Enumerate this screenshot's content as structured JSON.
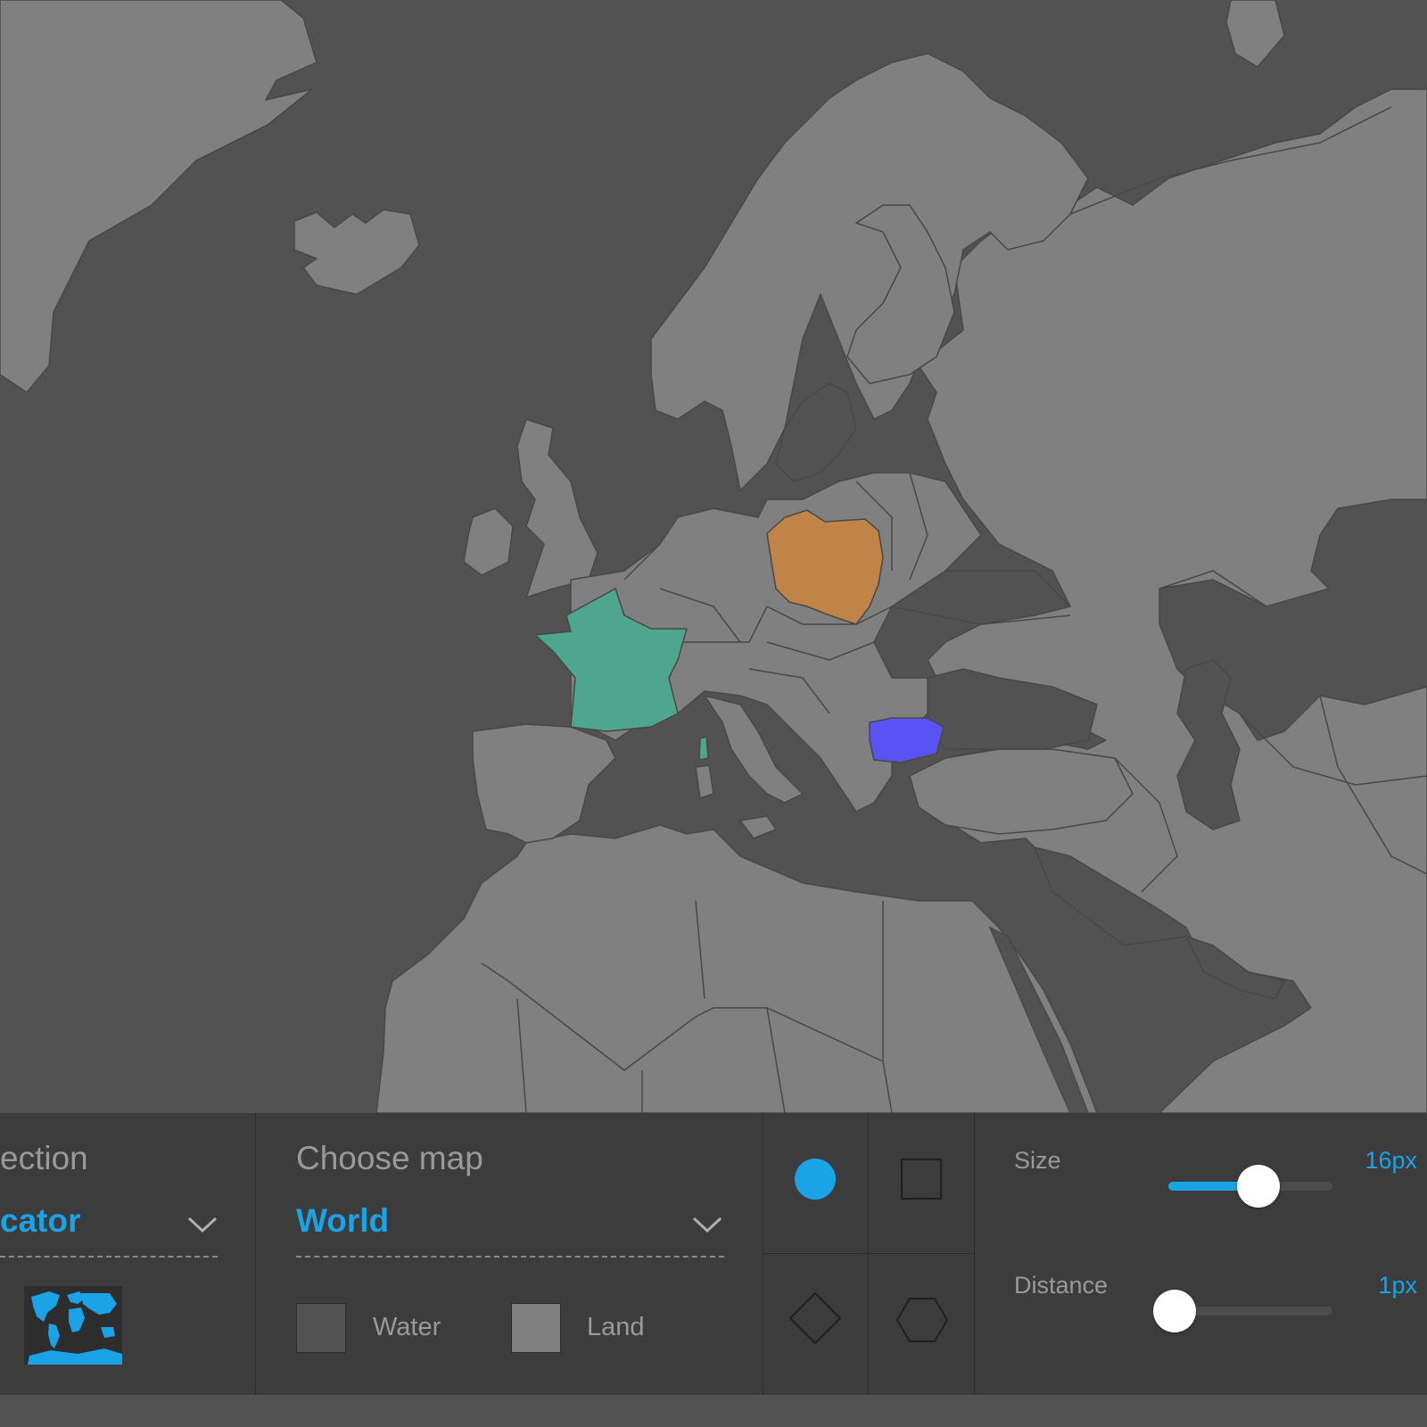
{
  "colors": {
    "water": "#525252",
    "land": "#808080",
    "accent": "#1aa3e6",
    "highlight_france": "#4fa68e",
    "highlight_poland": "#c08546",
    "highlight_bulgaria": "#5a52f2"
  },
  "panel": {
    "projection": {
      "heading": "ection",
      "selected": "cator",
      "thumbnail_icon": "world-map-thumbnail-icon"
    },
    "map_choice": {
      "heading": "Choose map",
      "selected": "World",
      "water_label": "Water",
      "land_label": "Land"
    },
    "shapes": {
      "items": [
        {
          "name": "circle",
          "selected": true
        },
        {
          "name": "square",
          "selected": false
        },
        {
          "name": "diamond",
          "selected": false
        },
        {
          "name": "hexagon",
          "selected": false
        }
      ]
    },
    "sliders": {
      "size": {
        "label": "Size",
        "value_text": "16px",
        "fraction": 0.55
      },
      "distance": {
        "label": "Distance",
        "value_text": "1px",
        "fraction": 0.04
      }
    }
  }
}
